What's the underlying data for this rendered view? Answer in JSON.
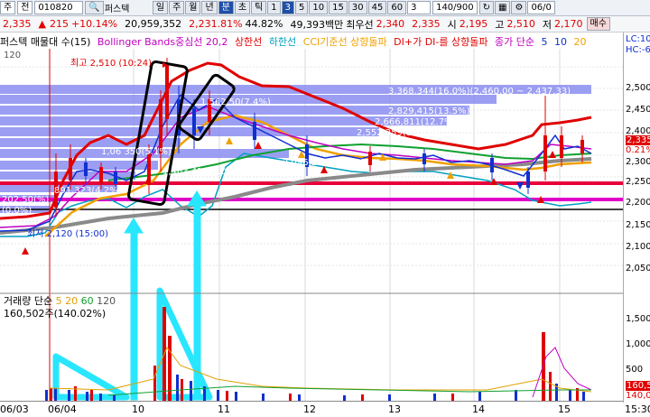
{
  "toolbar": {
    "market": "주",
    "market2": "전",
    "code": "010820",
    "name": "퍼스텍",
    "periods": [
      "일",
      "주",
      "월",
      "년",
      "분",
      "초",
      "틱"
    ],
    "active_period": "분",
    "intervals": [
      "1",
      "3",
      "5",
      "10",
      "15",
      "30",
      "45",
      "60"
    ],
    "active_interval": "3",
    "interval_value": "3",
    "count": "140/900",
    "date": "06/0",
    "buy": "매수"
  },
  "quote": {
    "price": "2,335",
    "change": "215",
    "change_pct": "+10.14%",
    "volume": "20,959,352",
    "vol_price": "2,231.81%",
    "vol_ratio": "44.82%",
    "trade_amount": "49,393백만",
    "best_ask_label": "최우선",
    "best_ask": "2,340",
    "best_bid": "2,335",
    "open_label": "시",
    "open": "2,195",
    "high_label": "고",
    "high": "2,510",
    "low_label": "저",
    "low": "2,170"
  },
  "legend": {
    "title": "퍼스텍 매물대 수(15)",
    "items": [
      {
        "label": "Bollinger Bands중심선 20,2",
        "color": "#c000c0"
      },
      {
        "label": "상한선",
        "color": "#e00000"
      },
      {
        "label": "하한선",
        "color": "#00a0c0"
      },
      {
        "label": "CCI기준선 상향돌파",
        "color": "#f0a000"
      },
      {
        "label": "DI+가 DI-를 상향돌파",
        "color": "#e00000"
      },
      {
        "label": "종가 단순",
        "color": "#c000c0"
      },
      {
        "label": "5",
        "color": "#1030d0"
      },
      {
        "label": "10",
        "color": "#1030d0"
      },
      {
        "label": "20",
        "color": "#f0a000"
      }
    ],
    "sidebar_top": "LC:10,",
    "sidebar_bottom": "HC:-6,",
    "y_top_label": "120"
  },
  "price_axis": {
    "ticks": [
      "2,500",
      "2,450",
      "2,400",
      "2,350",
      "2,300",
      "2,250",
      "2,200",
      "2,150",
      "2,100",
      "2,050"
    ],
    "current_price": "2,335",
    "current_pct": "0.21%"
  },
  "annotations": {
    "high_marker": "최고 2,510 (10:24)",
    "low_marker": "최저 2,120 (15:00)",
    "profile": [
      "3,368,344(16.0%)(2,460.00 ~ 2,437.33)",
      "2,829,415(13.5%)",
      "2,666,811(12.7%)",
      "2,552,359(12.1%)",
      "1,463,418(7.0%)",
      "2,096,201(10.0%)",
      "1,562,50(7.4%)",
      "1,06 350(5.1%)",
      "891,323(4.2%)",
      "(0.0%)",
      "202,50(%)"
    ]
  },
  "volume_panel": {
    "title": "거래량 단순",
    "ma": [
      "5",
      "20",
      "60",
      "120"
    ],
    "subtitle": "160,502주(140.02%)",
    "ticks": [
      "1,500",
      "1,000",
      "500"
    ],
    "badge_value": "160,50",
    "badge_pct": "140,02"
  },
  "x_axis": {
    "labels": [
      "06/03",
      "06/04",
      "10",
      "11",
      "12",
      "13",
      "14",
      "15"
    ],
    "right": "15:30"
  }
}
